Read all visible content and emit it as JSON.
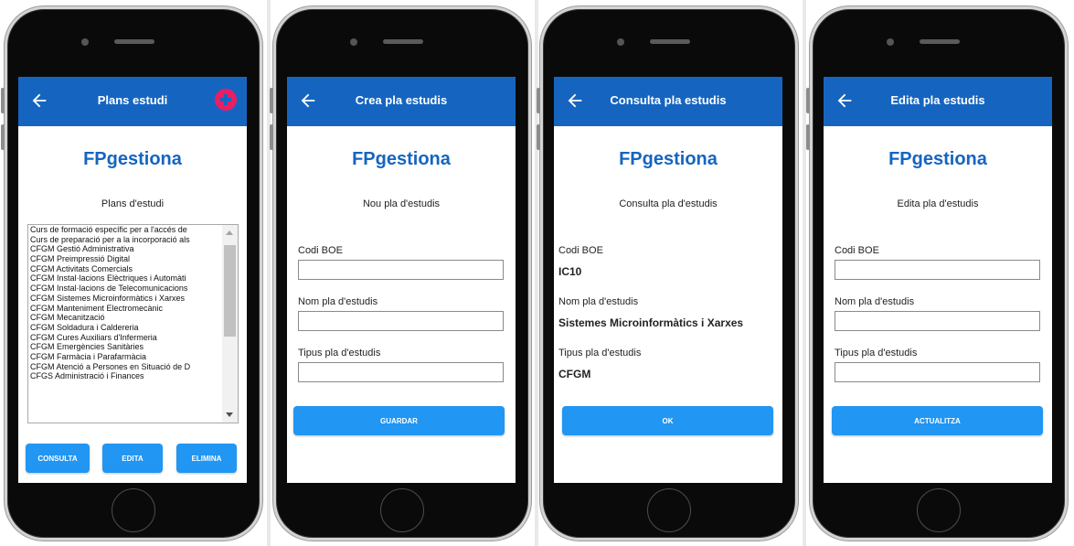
{
  "brand_name": "FPgestiona",
  "colors": {
    "appbar": "#1565c0",
    "button": "#2196f3",
    "add_icon": "#e91e63"
  },
  "icons": {
    "back": "arrow-left-icon",
    "add": "add-circle-icon"
  },
  "screens": {
    "list": {
      "title": "Plans estudi",
      "subtitle": "Plans d'estudi",
      "items": [
        "Curs de formació específic per a l'accés de",
        "Curs de preparació per a la incorporació als",
        "CFGM Gestió Administrativa",
        "CFGM Preimpressió Digital",
        "CFGM Activitats Comercials",
        "CFGM Instal·lacions Elèctriques i Automàti",
        "CFGM Instal·lacions de Telecomunicacions",
        "CFGM Sistemes Microinformàtics i Xarxes",
        "CFGM Manteniment Electromecànic",
        "CFGM Mecanització",
        "CFGM Soldadura i Caldereria",
        "CFGM Cures Auxiliars d'Infermeria",
        "CFGM Emergències Sanitàries",
        "CFGM Farmàcia i Parafarmàcia",
        "CFGM Atenció a Persones en Situació de D",
        "CFGS Administració i Finances"
      ],
      "buttons": {
        "consult": "CONSULTA",
        "edit": "EDITA",
        "delete": "ELIMINA"
      }
    },
    "create": {
      "title": "Crea pla estudis",
      "subtitle": "Nou pla d'estudis",
      "code_label": "Codi BOE",
      "name_label": "Nom pla d'estudis",
      "type_label": "Tipus pla d'estudis",
      "code_value": "",
      "name_value": "",
      "type_value": "",
      "button": "GUARDAR"
    },
    "consult": {
      "title": "Consulta pla estudis",
      "subtitle": "Consulta pla d'estudis",
      "code_label": "Codi BOE",
      "code_value": "IC10",
      "name_label": "Nom pla d'estudis",
      "name_value": "Sistemes Microinformàtics i Xarxes",
      "type_label": "Tipus pla d'estudis",
      "type_value": "CFGM",
      "button": "OK"
    },
    "edit": {
      "title": "Edita pla estudis",
      "subtitle": "Edita pla d'estudis",
      "code_label": "Codi BOE",
      "name_label": "Nom pla d'estudis",
      "type_label": "Tipus pla d'estudis",
      "code_value": "",
      "name_value": "",
      "type_value": "",
      "button": "ACTUALITZA"
    }
  }
}
